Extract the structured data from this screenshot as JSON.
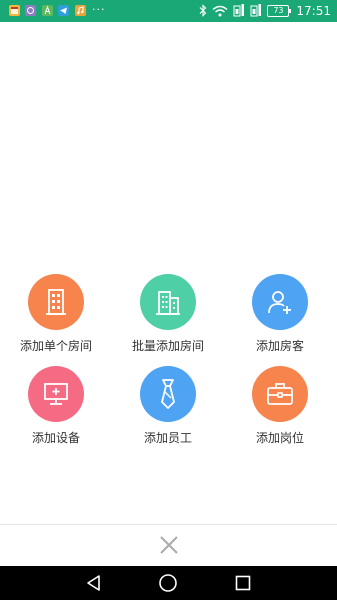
{
  "status_bar": {
    "time": "17:51",
    "battery": "73",
    "overflow": "···",
    "notification_icons": [
      "calendar-app-icon",
      "messenger-app-icon",
      "font-app-icon",
      "telegram-app-icon",
      "music-app-icon"
    ],
    "indicators": [
      "bluetooth-icon",
      "wifi-icon",
      "sim1-signal-icon",
      "sim2-signal-icon",
      "battery-icon"
    ]
  },
  "menu": {
    "items": [
      {
        "label": "添加单个房间",
        "icon": "building-icon",
        "color": "#f7844c"
      },
      {
        "label": "批量添加房间",
        "icon": "buildings-icon",
        "color": "#4fcfa6"
      },
      {
        "label": "添加房客",
        "icon": "add-person-icon",
        "color": "#4ea3f3"
      },
      {
        "label": "添加设备",
        "icon": "monitor-plus-icon",
        "color": "#f56b84"
      },
      {
        "label": "添加员工",
        "icon": "necktie-icon",
        "color": "#4ea3f3"
      },
      {
        "label": "添加岗位",
        "icon": "briefcase-icon",
        "color": "#f7844c"
      }
    ]
  },
  "close_icon": "close-icon",
  "nav": [
    "back-icon",
    "home-icon",
    "recents-icon"
  ],
  "colors": {
    "status_bar": "#1aa877",
    "label_text": "#333333",
    "close_icon": "#aaaaaa",
    "nav_bar": "#000000"
  }
}
